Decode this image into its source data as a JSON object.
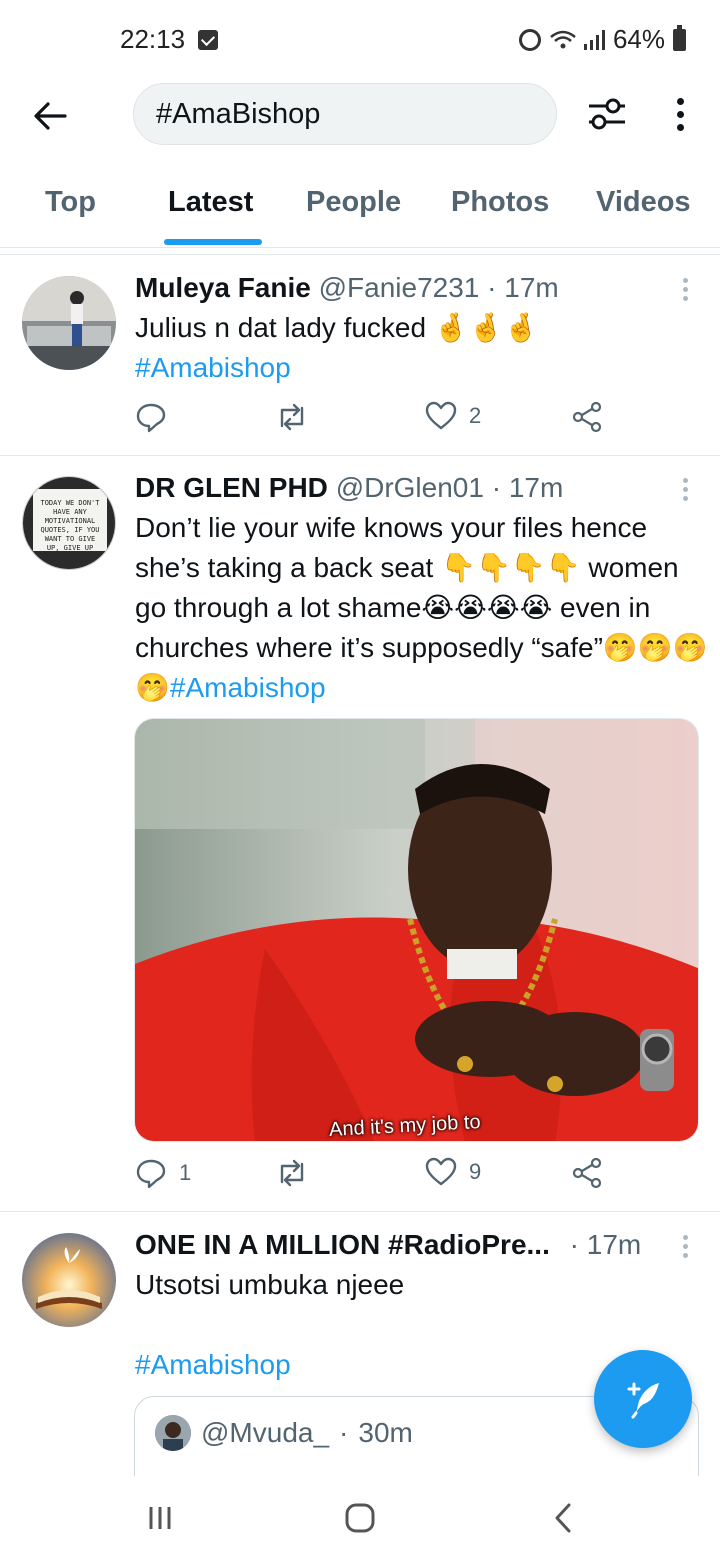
{
  "status_bar": {
    "time": "22:13",
    "battery": "64%",
    "icons": [
      "check-notification-icon",
      "alarm-icon",
      "wifi-icon",
      "signal-icon",
      "battery-icon"
    ]
  },
  "header": {
    "search_value": "#AmaBishop",
    "icons": [
      "back-arrow-icon",
      "filter-sliders-icon",
      "more-vertical-icon"
    ]
  },
  "tabs": [
    {
      "label": "Top",
      "active": false
    },
    {
      "label": "Latest",
      "active": true
    },
    {
      "label": "People",
      "active": false
    },
    {
      "label": "Photos",
      "active": false
    },
    {
      "label": "Videos",
      "active": false
    }
  ],
  "tweets": [
    {
      "name": "Muleya Fanie",
      "handle": "@Fanie7231",
      "time": "17m",
      "text": "Julius n dat lady fucked 🤞🤞🤞",
      "hashtag": "#Amabishop",
      "replies": "",
      "likes": "2"
    },
    {
      "name": "DR GLEN PHD",
      "handle": "@DrGlen01",
      "time": "17m",
      "text": "Don’t lie your wife knows your files hence she’s taking a back seat 👇👇👇👇 women go through a lot shame😭😭😭😭 even in churches where it’s supposedly “safe”🤭🤭🤭🤭",
      "hashtag": "#Amabishop",
      "avatar_text": "TODAY WE DON'T HAVE ANY MOTIVATIONAL QUOTES, IF YOU WANT TO GIVE UP, GIVE UP",
      "media_caption": "And it's my job to",
      "replies": "1",
      "likes": "9"
    },
    {
      "name": "ONE IN A MILLION #RadioPre...",
      "time": "17m",
      "text": "Utsotsi umbuka njeee",
      "hashtag": "#Amabishop",
      "quote": {
        "handle": "@Mvuda_",
        "time": "30m"
      }
    }
  ],
  "colors": {
    "accent": "#1d9bf0",
    "text": "#0f1419",
    "secondary": "#536471"
  }
}
